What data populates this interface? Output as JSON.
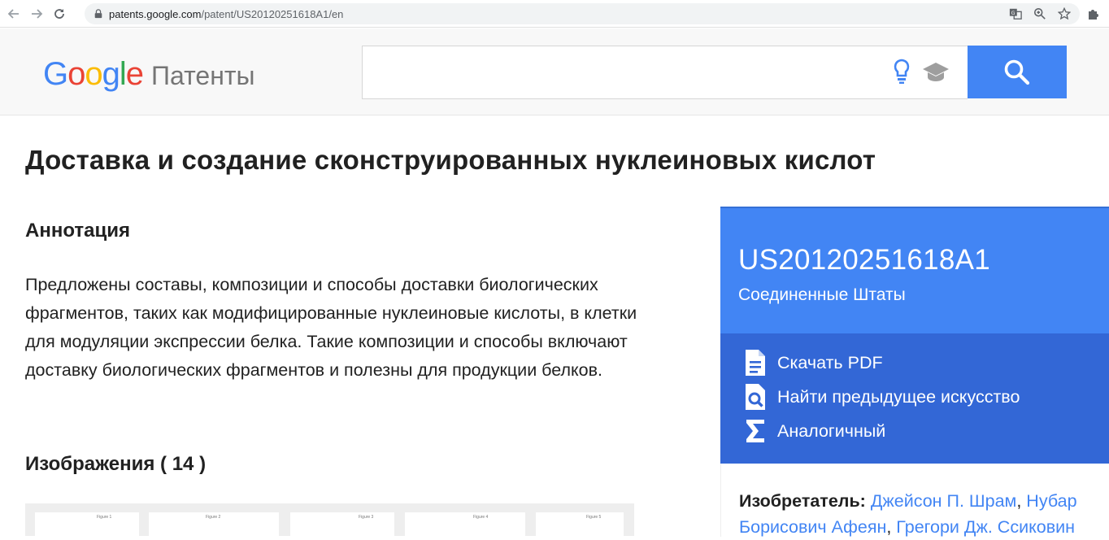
{
  "browser": {
    "url_host": "patents.google.com",
    "url_path": "/patent/US20120251618A1/en"
  },
  "header": {
    "logo_letters": [
      "G",
      "o",
      "o",
      "g",
      "l",
      "e"
    ],
    "product": "Патенты",
    "search_placeholder": "",
    "search_value": ""
  },
  "main": {
    "title": "Доставка и создание сконструированных нуклеиновых кислот",
    "abstract_heading": "Аннотация",
    "abstract_text": "Предложены составы, композиции и способы доставки биологических фрагментов, таких как модифицированные нуклеиновые кислоты, в клетки для модуляции экспрессии белка. Такие композиции и способы включают доставку биологических фрагментов и полезны для продукции белков.",
    "images_heading": "Изображения ( 14 )",
    "thumbnail_labels": [
      "Figure 1",
      "Figure 2",
      "Figure 3",
      "Figure 4",
      "Figure 5"
    ]
  },
  "panel": {
    "publication_number": "US20120251618A1",
    "country": "Соединенные Штаты",
    "actions": [
      {
        "label": "Скачать PDF",
        "icon": "pdf-document-icon"
      },
      {
        "label": "Найти предыдущее искусство",
        "icon": "prior-art-search-icon"
      },
      {
        "label": "Аналогичный",
        "icon": "sigma-similar-icon"
      }
    ],
    "inventor_label": "Изобретатель:",
    "inventors_line1_links": [
      "Джейсон П. Шрам",
      "Нубар"
    ],
    "inventors_line2_links": [
      "Борисович Афеян",
      "Грегори Дж. Ссиковин"
    ]
  },
  "colors": {
    "brand_blue": "#4285f4",
    "panel_dark_blue": "#3367d6"
  }
}
